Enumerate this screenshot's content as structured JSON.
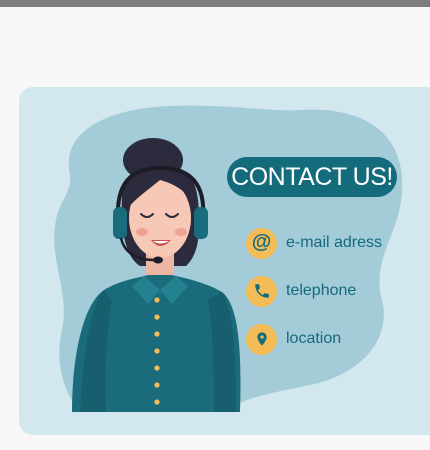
{
  "header": {
    "title": "CONTACT US!"
  },
  "contacts": [
    {
      "icon": "email-icon",
      "label": "e-mail adress"
    },
    {
      "icon": "phone-icon",
      "label": "telephone"
    },
    {
      "icon": "location-pin-icon",
      "label": "location"
    }
  ],
  "colors": {
    "card_background": "#d3e7ef",
    "blob": "#a4cbd8",
    "accent": "#146b7b",
    "icon_background": "#f4bc56",
    "page_background": "#f8f8f8",
    "top_bar": "#7d7d7d"
  }
}
